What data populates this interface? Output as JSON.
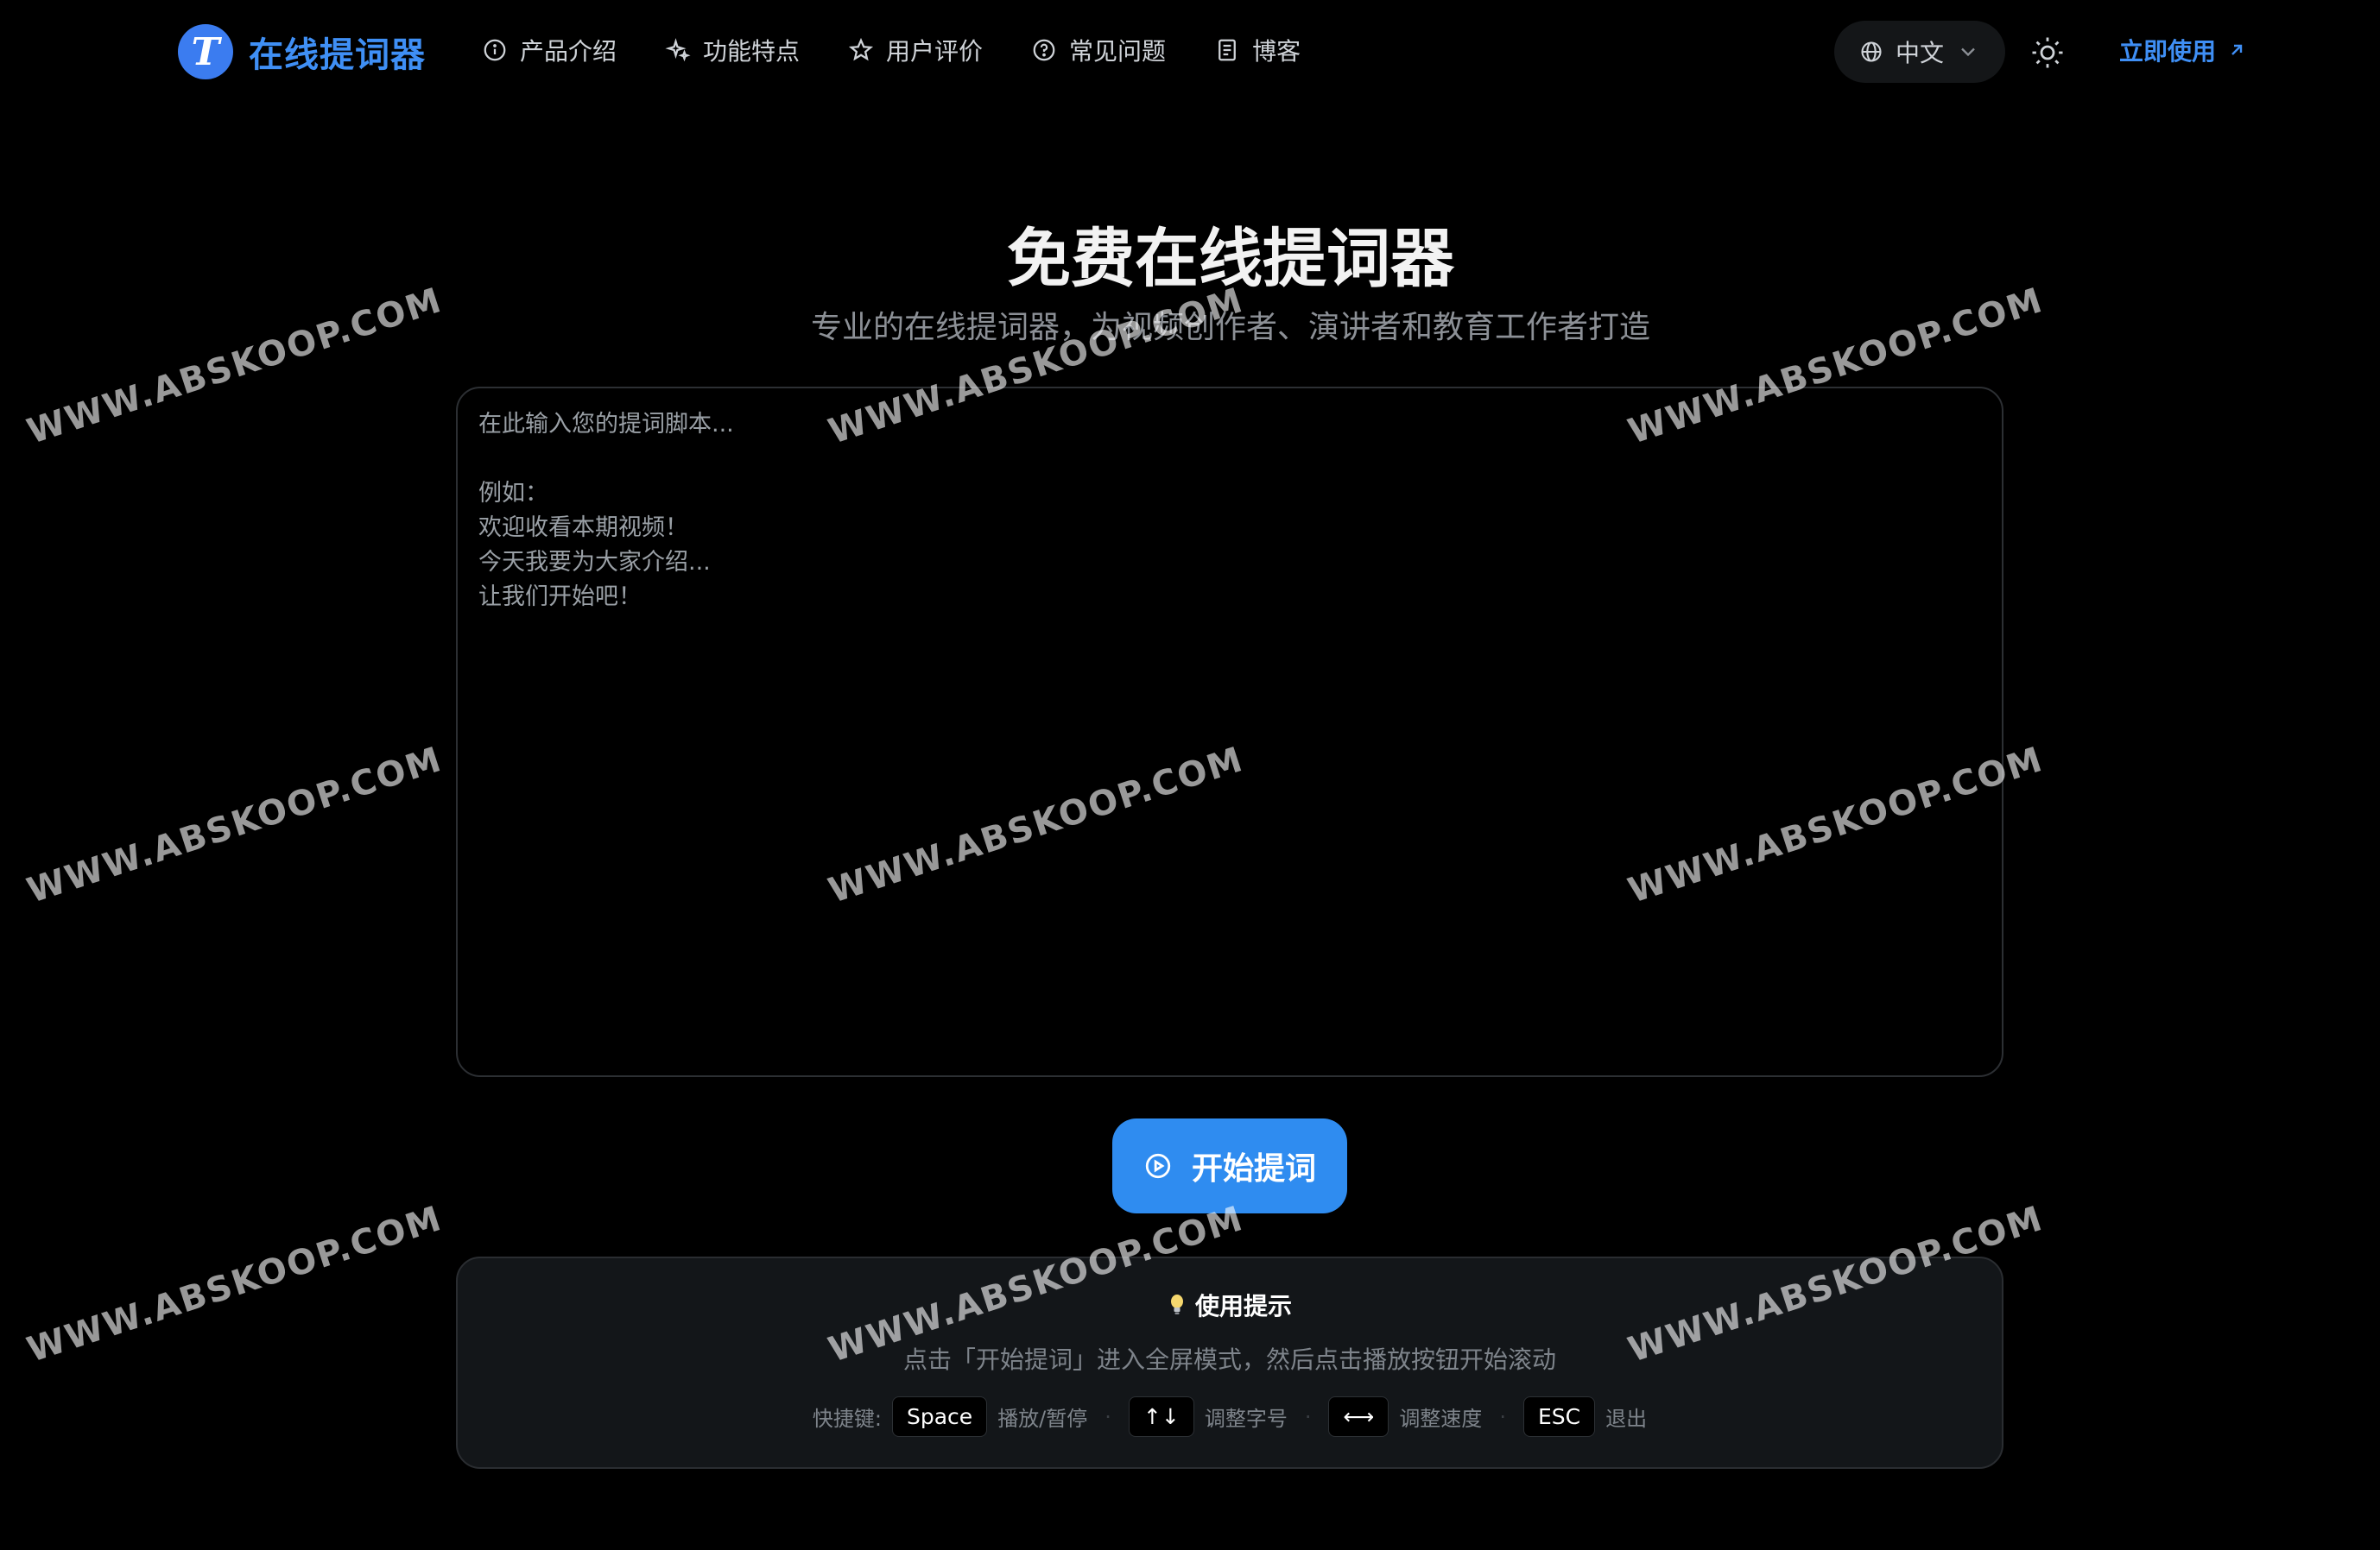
{
  "brand": {
    "logo_letter": "T",
    "name": "在线提词器",
    "color": "#3f8ff5"
  },
  "nav": {
    "items": [
      {
        "label": "产品介绍",
        "icon": "info-icon"
      },
      {
        "label": "功能特点",
        "icon": "sparkles-icon"
      },
      {
        "label": "用户评价",
        "icon": "star-icon"
      },
      {
        "label": "常见问题",
        "icon": "help-circle-icon"
      },
      {
        "label": "博客",
        "icon": "document-icon"
      }
    ],
    "language": "中文",
    "cta_label": "立即使用"
  },
  "hero": {
    "title": "免费在线提词器",
    "subtitle": "专业的在线提词器，为视频创作者、演讲者和教育工作者打造"
  },
  "editor": {
    "placeholder": "在此输入您的提词脚本...\n\n例如：\n欢迎收看本期视频！\n今天我要为大家介绍...\n让我们开始吧！",
    "value": ""
  },
  "start_button": {
    "label": "开始提词",
    "color": "#2f8cf0"
  },
  "tips": {
    "title": "使用提示",
    "description": "点击「开始提词」进入全屏模式，然后点击播放按钮开始滚动",
    "shortcuts_label": "快捷键:",
    "shortcuts": [
      {
        "key": "Space",
        "action": "播放/暂停"
      },
      {
        "key": "↑↓",
        "action": "调整字号"
      },
      {
        "key": "⟷",
        "action": "调整速度"
      },
      {
        "key": "ESC",
        "action": "退出"
      }
    ]
  },
  "watermark": "WWW.ABSKOOP.COM"
}
